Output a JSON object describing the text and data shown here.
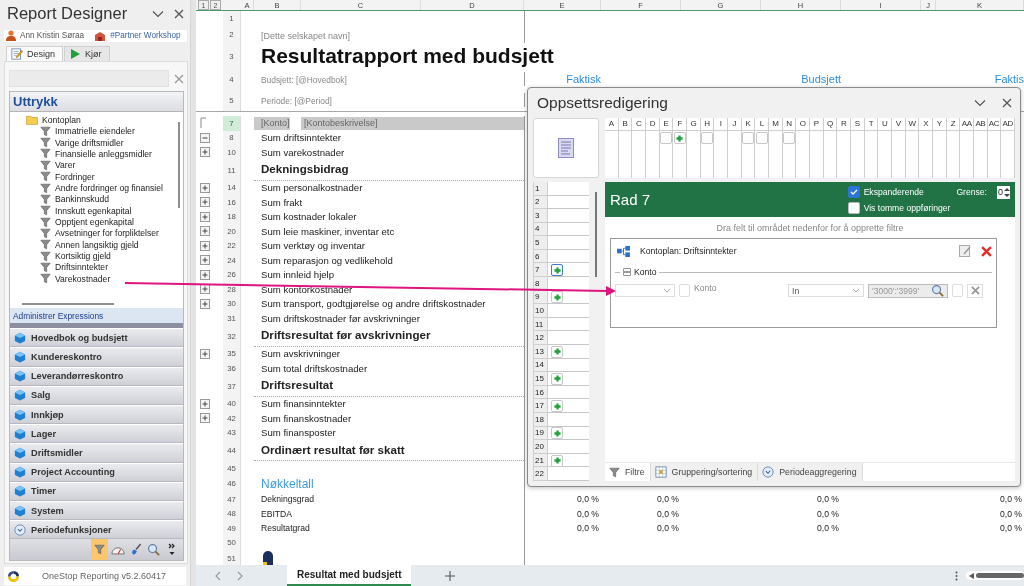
{
  "designer": {
    "title": "Report Designer",
    "user": "Ann Kristin Søraa",
    "workspace": "#Partner Workshop",
    "tabs": [
      {
        "label": "Design",
        "kind": "edit",
        "selected": true
      },
      {
        "label": "Kjør",
        "kind": "run",
        "selected": false
      }
    ],
    "expressions": {
      "title": "Uttrykk",
      "tree": [
        {
          "label": "Kontoplan",
          "kind": "folder",
          "children": [
            {
              "label": "Immatrielle eiendeler",
              "kind": "filter"
            },
            {
              "label": "Varige driftsmidler",
              "kind": "filter"
            },
            {
              "label": "Finansielle anleggsmidler",
              "kind": "filter"
            },
            {
              "label": "Varer",
              "kind": "filter"
            },
            {
              "label": "Fordringer",
              "kind": "filter"
            },
            {
              "label": "Andre fordringer og finansiel",
              "kind": "filter"
            },
            {
              "label": "Bankinnskudd",
              "kind": "filter"
            },
            {
              "label": "Innskutt egenkapital",
              "kind": "filter"
            },
            {
              "label": "Opptjent egenkapital",
              "kind": "filter"
            },
            {
              "label": "Avsetninger for forpliktelser",
              "kind": "filter"
            },
            {
              "label": "Annen langsiktig gjeld",
              "kind": "filter"
            },
            {
              "label": "Kortsiktig gjeld",
              "kind": "filter"
            },
            {
              "label": "Driftsinntekter",
              "kind": "filter"
            },
            {
              "label": "Varekostnader",
              "kind": "filter"
            }
          ]
        }
      ],
      "manage_link": "Administrer Expressions"
    },
    "categories": [
      {
        "label": "Hovedbok og budsjett",
        "kind": "cube"
      },
      {
        "label": "Kundereskontro",
        "kind": "cube"
      },
      {
        "label": "Leverandørreskontro",
        "kind": "cube"
      },
      {
        "label": "Salg",
        "kind": "cube"
      },
      {
        "label": "Innkjøp",
        "kind": "cube"
      },
      {
        "label": "Lager",
        "kind": "cube"
      },
      {
        "label": "Driftsmidler",
        "kind": "cube"
      },
      {
        "label": "Project Accounting",
        "kind": "cube"
      },
      {
        "label": "Timer",
        "kind": "cube"
      },
      {
        "label": "System",
        "kind": "cube"
      },
      {
        "label": "Periodefunksjoner",
        "kind": "clock"
      }
    ],
    "toolbar": [
      {
        "kind": "filter",
        "selected": true
      },
      {
        "kind": "gauge",
        "selected": false
      },
      {
        "kind": "brush",
        "selected": false
      },
      {
        "kind": "search",
        "selected": false
      },
      {
        "kind": "more",
        "selected": false
      }
    ],
    "version": "OneStop Reporting v5.2.60417"
  },
  "sheet": {
    "outline_levels": [
      "1",
      "2"
    ],
    "columns": [
      "A",
      "B",
      "C",
      "D",
      "E",
      "F",
      "G",
      "H",
      "I",
      "J",
      "K"
    ],
    "rows": [
      {
        "number": "1",
        "kind": "blank",
        "selected": false
      },
      {
        "number": "2",
        "kind": "company",
        "label": "[Dette selskapet navn]",
        "selected": false
      },
      {
        "number": "3",
        "kind": "title",
        "label": "Resultatrapport med budsjett",
        "selected": false
      },
      {
        "number": "4",
        "kind": "param",
        "label": "Budsjett: [@Hovedbok]",
        "cells": [
          "Faktisk",
          null,
          null,
          "Budsjett",
          null,
          null,
          "Faktis"
        ],
        "selected": false
      },
      {
        "number": "5",
        "kind": "param",
        "label": "Periode: [@Period]",
        "selected": false
      },
      {
        "number": "7",
        "kind": "detail",
        "outline": {
          "kind": "bracket"
        },
        "label": "[Konto]",
        "label_2": "[Kontobeskrivelse]",
        "selected": true
      },
      {
        "number": "8",
        "kind": "sum",
        "outline": {
          "kind": "collapse"
        },
        "label": "Sum driftsinntekter",
        "selected": false
      },
      {
        "number": "10",
        "kind": "sum",
        "outline": {
          "kind": "expand"
        },
        "label": "Sum varekostnader",
        "selected": false
      },
      {
        "number": "11",
        "kind": "heading",
        "label": "Dekningsbidrag",
        "selected": false
      },
      {
        "number": "14",
        "kind": "sum",
        "outline": {
          "kind": "expand"
        },
        "label": "Sum personalkostnader",
        "selected": false
      },
      {
        "number": "16",
        "kind": "sum",
        "outline": {
          "kind": "expand"
        },
        "label": "Sum frakt",
        "selected": false
      },
      {
        "number": "18",
        "kind": "sum",
        "outline": {
          "kind": "expand"
        },
        "label": "Sum kostnader lokaler",
        "selected": false
      },
      {
        "number": "20",
        "kind": "sum",
        "outline": {
          "kind": "expand"
        },
        "label": "Sum leie maskiner, inventar etc",
        "selected": false
      },
      {
        "number": "22",
        "kind": "sum",
        "outline": {
          "kind": "expand"
        },
        "label": "Sum verktøy og inventar",
        "selected": false
      },
      {
        "number": "24",
        "kind": "sum",
        "outline": {
          "kind": "expand"
        },
        "label": "Sum reparasjon og vedlikehold",
        "selected": false
      },
      {
        "number": "26",
        "kind": "sum",
        "outline": {
          "kind": "expand"
        },
        "label": "Sum innleid hjelp",
        "selected": false
      },
      {
        "number": "28",
        "kind": "sum",
        "outline": {
          "kind": "expand"
        },
        "label": "Sum kontorkostnader",
        "selected": false
      },
      {
        "number": "30",
        "kind": "sum",
        "outline": {
          "kind": "expand"
        },
        "label": "Sum transport, godtgjørelse og andre driftskostnader",
        "selected": false
      },
      {
        "number": "31",
        "kind": "sum",
        "label": "Sum driftskostnader før avskrivninger",
        "selected": false
      },
      {
        "number": "32",
        "kind": "heading",
        "label": "Driftsresultat før avskrivninger",
        "selected": false
      },
      {
        "number": "35",
        "kind": "sum",
        "outline": {
          "kind": "expand"
        },
        "label": "Sum avskrivninger",
        "selected": false
      },
      {
        "number": "36",
        "kind": "sum",
        "label": "Sum total driftskostnader",
        "selected": false
      },
      {
        "number": "37",
        "kind": "heading",
        "label": "Driftsresultat",
        "selected": false
      },
      {
        "number": "40",
        "kind": "sum",
        "outline": {
          "kind": "expand"
        },
        "label": "Sum finansinntekter",
        "selected": false
      },
      {
        "number": "42",
        "kind": "sum",
        "outline": {
          "kind": "expand"
        },
        "label": "Sum finanskostnader",
        "selected": false
      },
      {
        "number": "43",
        "kind": "sum",
        "label": "Sum finansposter",
        "selected": false
      },
      {
        "number": "44",
        "kind": "heading",
        "label": "Ordinært resultat før skatt",
        "selected": false
      },
      {
        "number": "45",
        "kind": "blank",
        "selected": false
      },
      {
        "number": "46",
        "kind": "key",
        "label": "Nøkkeltall",
        "selected": false
      },
      {
        "number": "47",
        "kind": "ratio",
        "label": "Dekningsgrad",
        "cells": [
          "0,0 %",
          "0,0 %",
          null,
          "0,0 %",
          null,
          null,
          "0,0 %"
        ],
        "selected": false
      },
      {
        "number": "48",
        "kind": "ratio",
        "label": "EBITDA",
        "cells": [
          "0,0 %",
          "0,0 %",
          null,
          "0,0 %",
          null,
          null,
          "0,0 %"
        ],
        "selected": false
      },
      {
        "number": "49",
        "kind": "ratio",
        "label": "Resultatgrad",
        "cells": [
          "0,0 %",
          "0,0 %",
          null,
          "0,0 %",
          null,
          null,
          "0,0 %"
        ],
        "selected": false
      },
      {
        "number": "50",
        "kind": "blank",
        "selected": false
      },
      {
        "number": "51",
        "kind": "logo",
        "selected": false
      }
    ],
    "tabs": [
      {
        "label": "Resultat med budsjett",
        "selected": true
      }
    ]
  },
  "layout_editor": {
    "title": "Oppsettsredigering",
    "columns": [
      {
        "letter": "A",
        "kind": "plain"
      },
      {
        "letter": "B",
        "kind": "plain"
      },
      {
        "letter": "C",
        "kind": "plain"
      },
      {
        "letter": "D",
        "kind": "plain"
      },
      {
        "letter": "E",
        "kind": "empty"
      },
      {
        "letter": "F",
        "kind": "filter"
      },
      {
        "letter": "G",
        "kind": "plain"
      },
      {
        "letter": "H",
        "kind": "empty"
      },
      {
        "letter": "I",
        "kind": "plain"
      },
      {
        "letter": "J",
        "kind": "plain"
      },
      {
        "letter": "K",
        "kind": "empty"
      },
      {
        "letter": "L",
        "kind": "empty"
      },
      {
        "letter": "M",
        "kind": "plain"
      },
      {
        "letter": "N",
        "kind": "empty"
      },
      {
        "letter": "O",
        "kind": "plain"
      },
      {
        "letter": "P",
        "kind": "plain"
      },
      {
        "letter": "Q",
        "kind": "plain"
      },
      {
        "letter": "R",
        "kind": "plain"
      },
      {
        "letter": "S",
        "kind": "plain"
      },
      {
        "letter": "T",
        "kind": "plain"
      },
      {
        "letter": "U",
        "kind": "plain"
      },
      {
        "letter": "V",
        "kind": "plain"
      },
      {
        "letter": "W",
        "kind": "plain"
      },
      {
        "letter": "X",
        "kind": "plain"
      },
      {
        "letter": "Y",
        "kind": "plain"
      },
      {
        "letter": "Z",
        "kind": "plain"
      },
      {
        "letter": "AA",
        "kind": "plain"
      },
      {
        "letter": "AB",
        "kind": "plain"
      },
      {
        "letter": "AC",
        "kind": "plain"
      },
      {
        "letter": "AD",
        "kind": "plain"
      }
    ],
    "rows": [
      {
        "number": "1",
        "kind": "plain",
        "selected": false
      },
      {
        "number": "2",
        "kind": "plain",
        "selected": false
      },
      {
        "number": "3",
        "kind": "plain",
        "selected": false
      },
      {
        "number": "4",
        "kind": "plain",
        "selected": false
      },
      {
        "number": "5",
        "kind": "plain",
        "selected": false
      },
      {
        "number": "6",
        "kind": "plain",
        "selected": false
      },
      {
        "number": "7",
        "kind": "filter",
        "selected": true
      },
      {
        "number": "8",
        "kind": "plain",
        "selected": false
      },
      {
        "number": "9",
        "kind": "filter",
        "selected": false
      },
      {
        "number": "10",
        "kind": "plain",
        "selected": false
      },
      {
        "number": "11",
        "kind": "plain",
        "selected": false
      },
      {
        "number": "12",
        "kind": "plain",
        "selected": false
      },
      {
        "number": "13",
        "kind": "filter",
        "selected": false
      },
      {
        "number": "14",
        "kind": "plain",
        "selected": false
      },
      {
        "number": "15",
        "kind": "filter",
        "selected": false
      },
      {
        "number": "16",
        "kind": "plain",
        "selected": false
      },
      {
        "number": "17",
        "kind": "filter",
        "selected": false
      },
      {
        "number": "18",
        "kind": "plain",
        "selected": false
      },
      {
        "number": "19",
        "kind": "filter",
        "selected": false
      },
      {
        "number": "20",
        "kind": "plain",
        "selected": false
      },
      {
        "number": "21",
        "kind": "filter",
        "selected": false
      },
      {
        "number": "22",
        "kind": "plain",
        "selected": false
      }
    ],
    "panel": {
      "title": "Rad 7",
      "expanding": {
        "label": "Ekspanderende",
        "checked": true
      },
      "show_empty": {
        "label": "Vis tomme oppføringer",
        "checked": false
      },
      "limit_label": "Grense:",
      "limit": "0",
      "hint": "Dra felt til området nedenfor for å opprette filtre",
      "filter": {
        "title": "Kontoplan: Driftsinntekter",
        "group": "Konto",
        "expanded": true,
        "field_checked": false,
        "field": "Konto",
        "operator": "In",
        "value": "'3000':'3999'"
      }
    },
    "tabs": [
      {
        "label": "Filtre",
        "kind": "filter",
        "selected": true
      },
      {
        "label": "Gruppering/sortering",
        "kind": "grid",
        "selected": false
      },
      {
        "label": "Periodeaggregering",
        "kind": "clock",
        "selected": false
      }
    ]
  }
}
